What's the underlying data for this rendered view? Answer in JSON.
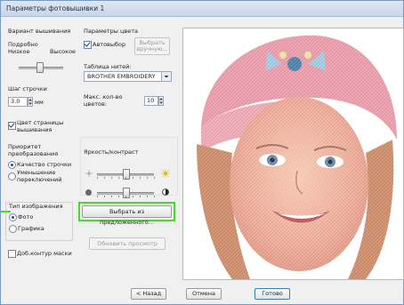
{
  "window": {
    "title": "Параметры фотовышивки 1"
  },
  "left_panel": {
    "embroidery_variant": {
      "title": "Вариант вышивания",
      "detail_label": "Подробно",
      "low_label": "Низкое",
      "high_label": "Высокое",
      "level": 0.45
    },
    "stitch_step": {
      "label": "Шаг строчки",
      "value": "3.0",
      "unit": "мм"
    },
    "page_color": {
      "label": "Цвет страницы вышивания",
      "checked": true
    },
    "transform_priority": {
      "title": "Приоритет преобразования",
      "options": [
        {
          "label": "Качество строчки",
          "selected": true
        },
        {
          "label": "Уменьшение переключений",
          "selected": false
        }
      ]
    },
    "image_type": {
      "title": "Тип изображения",
      "options": [
        {
          "label": "Фото",
          "selected": true
        },
        {
          "label": "Графика",
          "selected": false
        }
      ]
    },
    "extra_contour": {
      "label": "Доб.контур маски",
      "checked": false
    }
  },
  "color_params": {
    "title": "Параметры цвета",
    "auto_select": {
      "label": "Автовыбор",
      "checked": true
    },
    "manual_button": "Выбрать вручную...",
    "thread_table_label": "Таблица нитей:",
    "thread_table_value": "BROTHER EMBROIDERY",
    "max_colors_label": "Макс. кол-во цветов:",
    "max_colors_value": "10"
  },
  "brightness_contrast": {
    "title": "Яркость/контраст",
    "brightness": 0.5,
    "contrast": 0.5
  },
  "buttons": {
    "choose_suggested": "Выбрать из предложенного...",
    "refresh_preview": "Обновить просмотр",
    "back": "< Назад",
    "cancel": "Отмена",
    "done": "Готово"
  },
  "colors": {
    "highlight": "#44dd22",
    "window_border": "#7a9bbf",
    "title_bar": "#c7d6e8"
  },
  "icons": [
    "sun-small-icon",
    "sun-large-icon",
    "contrast-low-icon",
    "contrast-high-icon",
    "dropdown-arrow-icon",
    "spin-arrows-icon"
  ]
}
